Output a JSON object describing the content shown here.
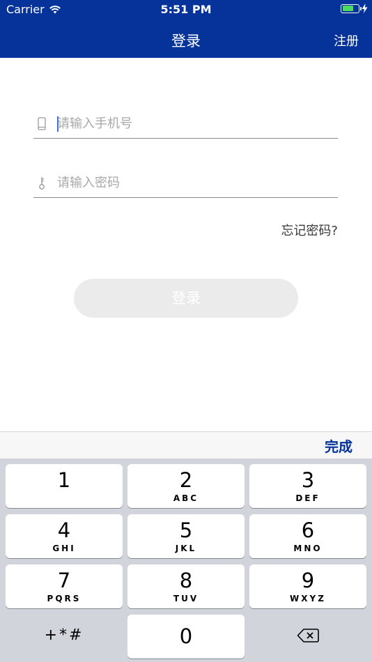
{
  "status_bar": {
    "carrier": "Carrier",
    "time": "5:51 PM"
  },
  "nav": {
    "title": "登录",
    "register": "注册"
  },
  "form": {
    "phone_placeholder": "请输入手机号",
    "password_placeholder": "请输入密码",
    "forgot_password": "忘记密码?",
    "login_button": "登录"
  },
  "keyboard": {
    "done": "完成",
    "keys": [
      {
        "num": "1",
        "letters": ""
      },
      {
        "num": "2",
        "letters": "ABC"
      },
      {
        "num": "3",
        "letters": "DEF"
      },
      {
        "num": "4",
        "letters": "GHI"
      },
      {
        "num": "5",
        "letters": "JKL"
      },
      {
        "num": "6",
        "letters": "MNO"
      },
      {
        "num": "7",
        "letters": "PQRS"
      },
      {
        "num": "8",
        "letters": "TUV"
      },
      {
        "num": "9",
        "letters": "WXYZ"
      },
      {
        "num": "0",
        "letters": ""
      }
    ],
    "symbols": "+*#"
  },
  "colors": {
    "nav_bg": "#05339a",
    "accent": "#05339a",
    "battery": "#4cd964"
  }
}
